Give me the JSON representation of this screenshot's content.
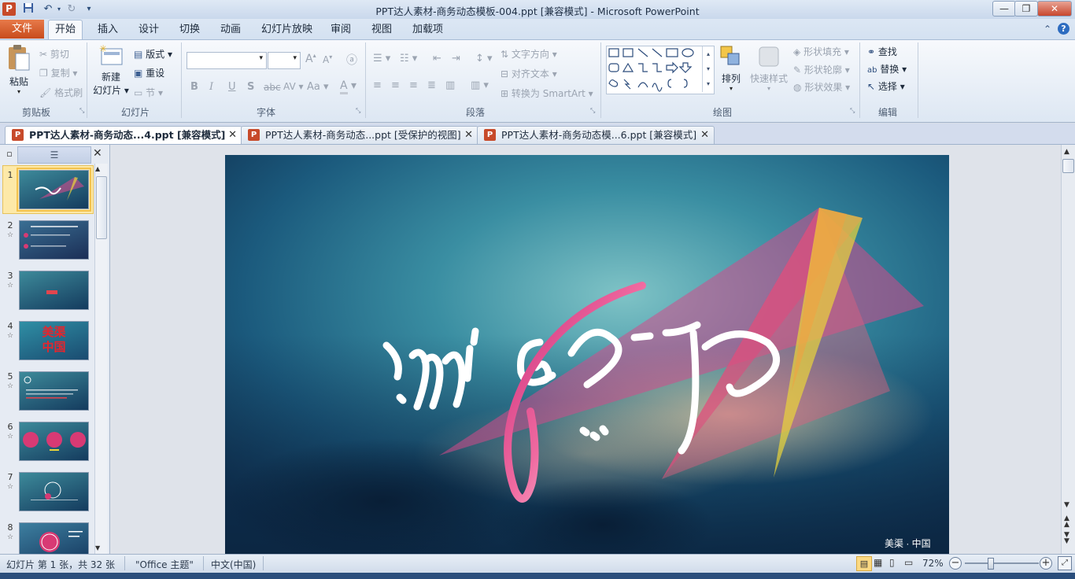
{
  "titlebar": {
    "title": "PPT达人素材-商务动态模板-004.ppt [兼容模式]  -  Microsoft PowerPoint",
    "app_icon": "P",
    "quick_access": [
      "save-icon",
      "undo-icon",
      "redo-icon",
      "customize-icon"
    ],
    "window_buttons": [
      "minimize",
      "restore",
      "close"
    ]
  },
  "ribbon_tabs": [
    "文件",
    "开始",
    "插入",
    "设计",
    "切换",
    "动画",
    "幻灯片放映",
    "审阅",
    "视图",
    "加载项"
  ],
  "ribbon": {
    "clipboard": {
      "label": "剪贴板",
      "paste": "粘贴",
      "cut": "剪切",
      "copy": "复制",
      "format_painter": "格式刷"
    },
    "slides": {
      "label": "幻灯片",
      "new_slide_1": "新建",
      "new_slide_2": "幻灯片",
      "layout": "版式",
      "reset": "重设",
      "section": "节"
    },
    "font": {
      "label": "字体",
      "bold": "B",
      "italic": "I",
      "underline": "U",
      "shadow": "S",
      "strike": "abc",
      "spacing": "AV",
      "case": "Aa",
      "color": "A",
      "grow": "A",
      "shrink": "A"
    },
    "paragraph": {
      "label": "段落",
      "text_direction": "文字方向",
      "align_text": "对齐文本",
      "smartart": "转换为 SmartArt"
    },
    "drawing": {
      "label": "绘图",
      "arrange": "排列",
      "quick_styles": "快速样式",
      "shape_fill": "形状填充",
      "shape_outline": "形状轮廓",
      "shape_effects": "形状效果"
    },
    "editing": {
      "label": "编辑",
      "find": "查找",
      "replace": "替换",
      "select": "选择"
    }
  },
  "doc_tabs": [
    {
      "label": "PPT达人素材-商务动态...4.ppt [兼容模式]",
      "active": true
    },
    {
      "label": "PPT达人素材-商务动态...ppt [受保护的视图]",
      "active": false
    },
    {
      "label": "PPT达人素材-商务动态模...6.ppt [兼容模式]",
      "active": false
    }
  ],
  "slides": [
    {
      "num": "1",
      "star": "",
      "kind": "title"
    },
    {
      "num": "2",
      "star": "☆",
      "kind": "list"
    },
    {
      "num": "3",
      "star": "☆",
      "kind": "plain"
    },
    {
      "num": "4",
      "star": "☆",
      "kind": "red",
      "text1": "美渠",
      "text2": "中国"
    },
    {
      "num": "5",
      "star": "☆",
      "kind": "text"
    },
    {
      "num": "6",
      "star": "☆",
      "kind": "circles"
    },
    {
      "num": "7",
      "star": "☆",
      "kind": "ring"
    },
    {
      "num": "8",
      "star": "☆",
      "kind": "badge"
    }
  ],
  "slide": {
    "footer": "美渠 · 中国",
    "colors": {
      "bg_top": "#2a7e91",
      "bg_bottom": "#10324f",
      "accent_pink": "#d83a74",
      "accent_yellow": "#e7d23c"
    }
  },
  "statusbar": {
    "slide_info": "幻灯片 第 1 张，共 32 张",
    "theme": "\"Office 主题\"",
    "language": "中文(中国)",
    "zoom": "72%",
    "zoom_value": 0.72
  }
}
